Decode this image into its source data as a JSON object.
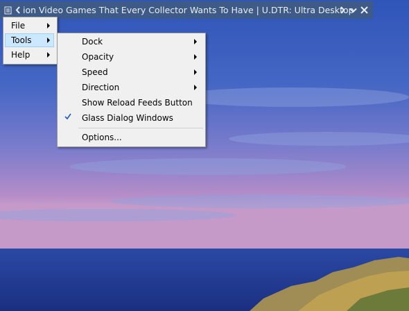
{
  "ticker": {
    "feed_text": "ion Video Games That Every Collector Wants To Have  |  U.DTR: Ultra Desktop",
    "icons": [
      "feed-icon",
      "prev-icon",
      "next-icon",
      "chevron-down-icon",
      "close-icon"
    ],
    "bg_color": "#3e5a86"
  },
  "main_menu": {
    "items": [
      {
        "label": "File",
        "has_submenu": true
      },
      {
        "label": "Tools",
        "has_submenu": true,
        "highlighted": true
      },
      {
        "label": "Help",
        "has_submenu": true
      }
    ]
  },
  "tools_submenu": {
    "items": [
      {
        "label": "Dock",
        "has_submenu": true
      },
      {
        "label": "Opacity",
        "has_submenu": true
      },
      {
        "label": "Speed",
        "has_submenu": true
      },
      {
        "label": "Direction",
        "has_submenu": true
      },
      {
        "label": "Show Reload Feeds Button",
        "checked": false
      },
      {
        "label": "Glass Dialog Windows",
        "checked": true
      },
      {
        "label": "Options...",
        "has_submenu": false
      }
    ]
  },
  "colors": {
    "highlight_bg": "#cce8ff",
    "highlight_border": "#99d1ff",
    "menu_bg": "#f0f0f0"
  }
}
